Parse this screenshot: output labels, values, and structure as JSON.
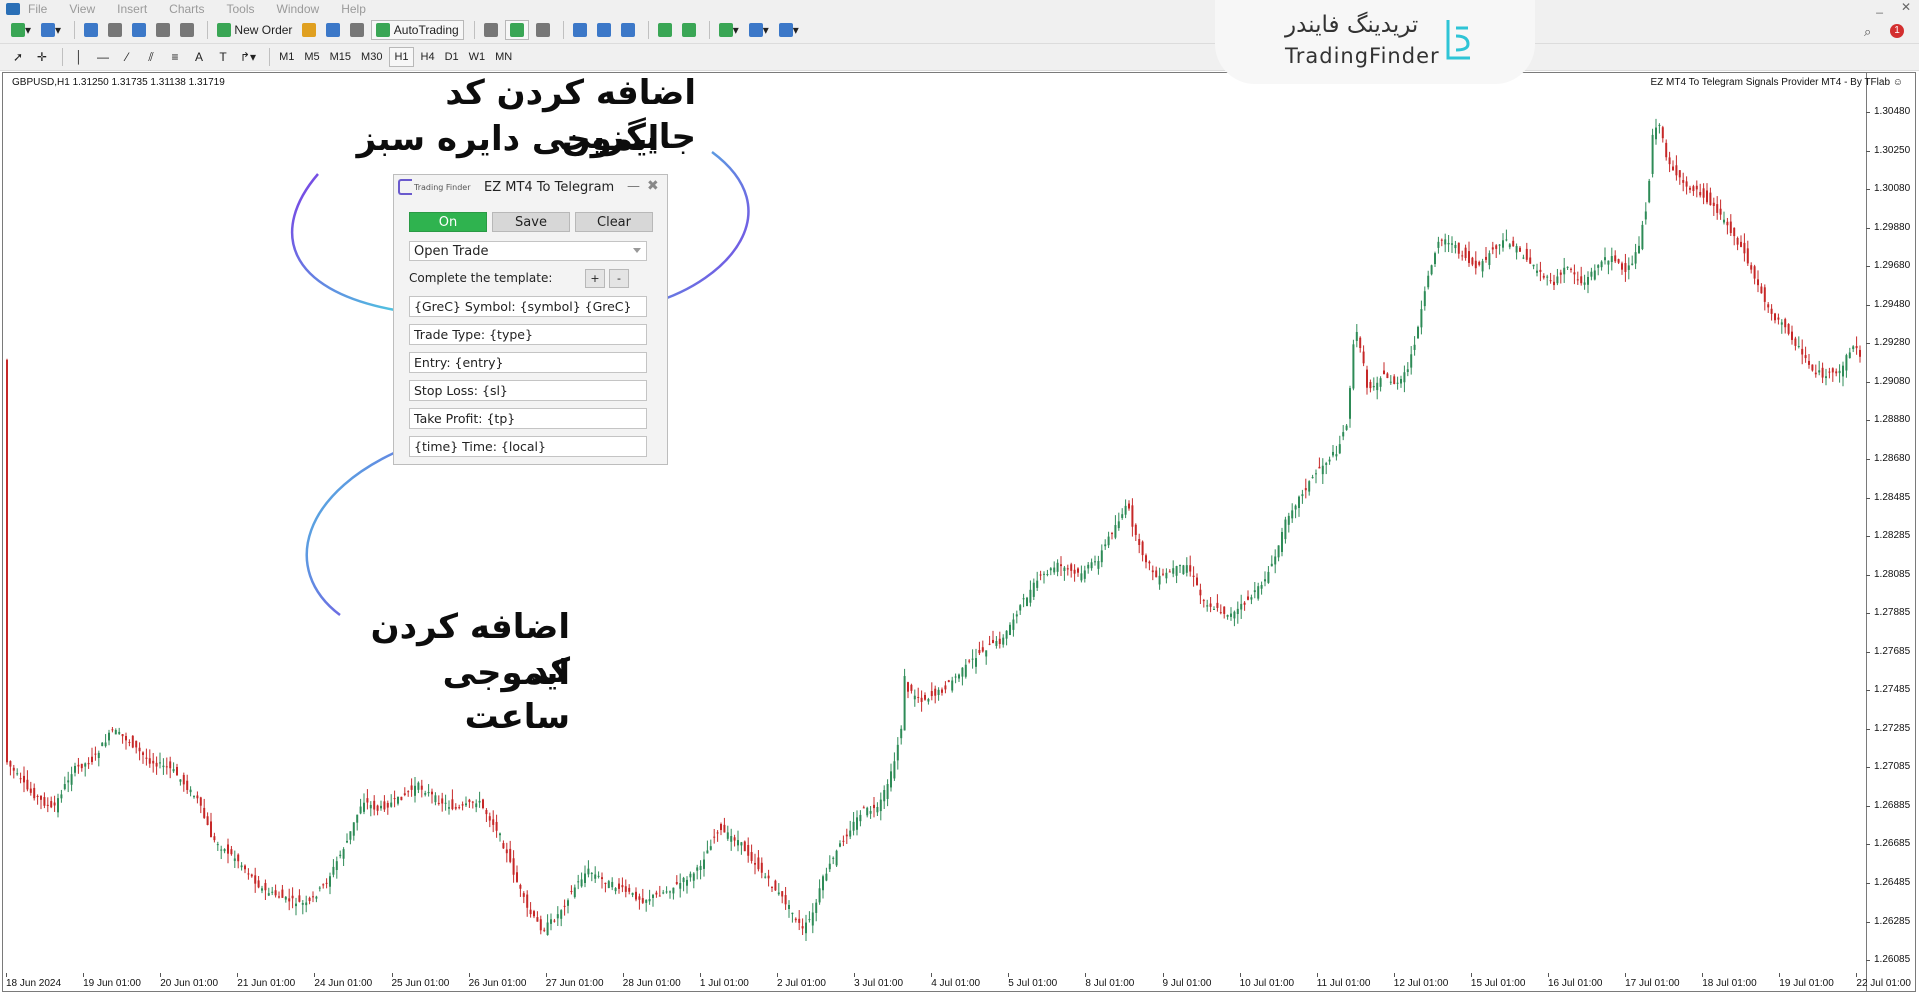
{
  "menu": {
    "items": [
      "File",
      "View",
      "Insert",
      "Charts",
      "Tools",
      "Window",
      "Help"
    ]
  },
  "toolbar": {
    "new_order_label": "New Order",
    "autotrading_label": "AutoTrading",
    "timeframes": [
      "M1",
      "M5",
      "M15",
      "M30",
      "H1",
      "H4",
      "D1",
      "W1",
      "MN"
    ],
    "active_timeframe": "H1",
    "alert_count": "1"
  },
  "chart": {
    "symbol_info": "GBPUSD,H1  1.31250 1.31735 1.31138 1.31719",
    "ea_title": "EZ MT4 To Telegram Signals Provider MT4 - By TFlab ☺",
    "price_labels": [
      "1.30480",
      "1.30250",
      "1.30080",
      "1.29880",
      "1.29680",
      "1.29480",
      "1.29280",
      "1.29080",
      "1.28880",
      "1.28680",
      "1.28485",
      "1.28285",
      "1.28085",
      "1.27885",
      "1.27685",
      "1.27485",
      "1.27285",
      "1.27085",
      "1.26885",
      "1.26685",
      "1.26485",
      "1.26285",
      "1.26085"
    ],
    "time_labels": [
      "18 Jun 2024",
      "19 Jun 01:00",
      "20 Jun 01:00",
      "21 Jun 01:00",
      "24 Jun 01:00",
      "25 Jun 01:00",
      "26 Jun 01:00",
      "27 Jun 01:00",
      "28 Jun 01:00",
      "1 Jul 01:00",
      "2 Jul 01:00",
      "3 Jul 01:00",
      "4 Jul 01:00",
      "5 Jul 01:00",
      "8 Jul 01:00",
      "9 Jul 01:00",
      "10 Jul 01:00",
      "11 Jul 01:00",
      "12 Jul 01:00",
      "15 Jul 01:00",
      "16 Jul 01:00",
      "17 Jul 01:00",
      "18 Jul 01:00",
      "19 Jul 01:00",
      "22 Jul 01:00"
    ],
    "bull_color": "#2e8b57",
    "bear_color": "#c62828"
  },
  "dialog": {
    "brand": "Trading Finder",
    "title": "EZ MT4 To Telegram",
    "minimize": "—",
    "close": "✖",
    "on_label": "On",
    "save_label": "Save",
    "clear_label": "Clear",
    "mode_value": "Open Trade",
    "template_label": "Complete the template:",
    "plus_label": "+",
    "minus_label": "-",
    "fields": [
      "{GreC} Symbol: {symbol} {GreC}",
      "Trade Type: {type}",
      "Entry: {entry}",
      "Stop Loss: {sl}",
      "Take Profit: {tp}",
      "{time} Time: {local}"
    ]
  },
  "annotations": {
    "top_line1": "اضافه کردن کد جایگزین",
    "top_line2": "ایموجی دایره سبز",
    "bottom_line1": "اضافه کردن کد",
    "bottom_line2": "ایموجی ساعت"
  },
  "logo": {
    "fa": "تریدینگ فایندر",
    "en": "TradingFinder"
  },
  "colors": {
    "accent_purple": "#7b3fe4",
    "accent_cyan": "#4fc3e0",
    "on_green": "#2fb34f"
  }
}
